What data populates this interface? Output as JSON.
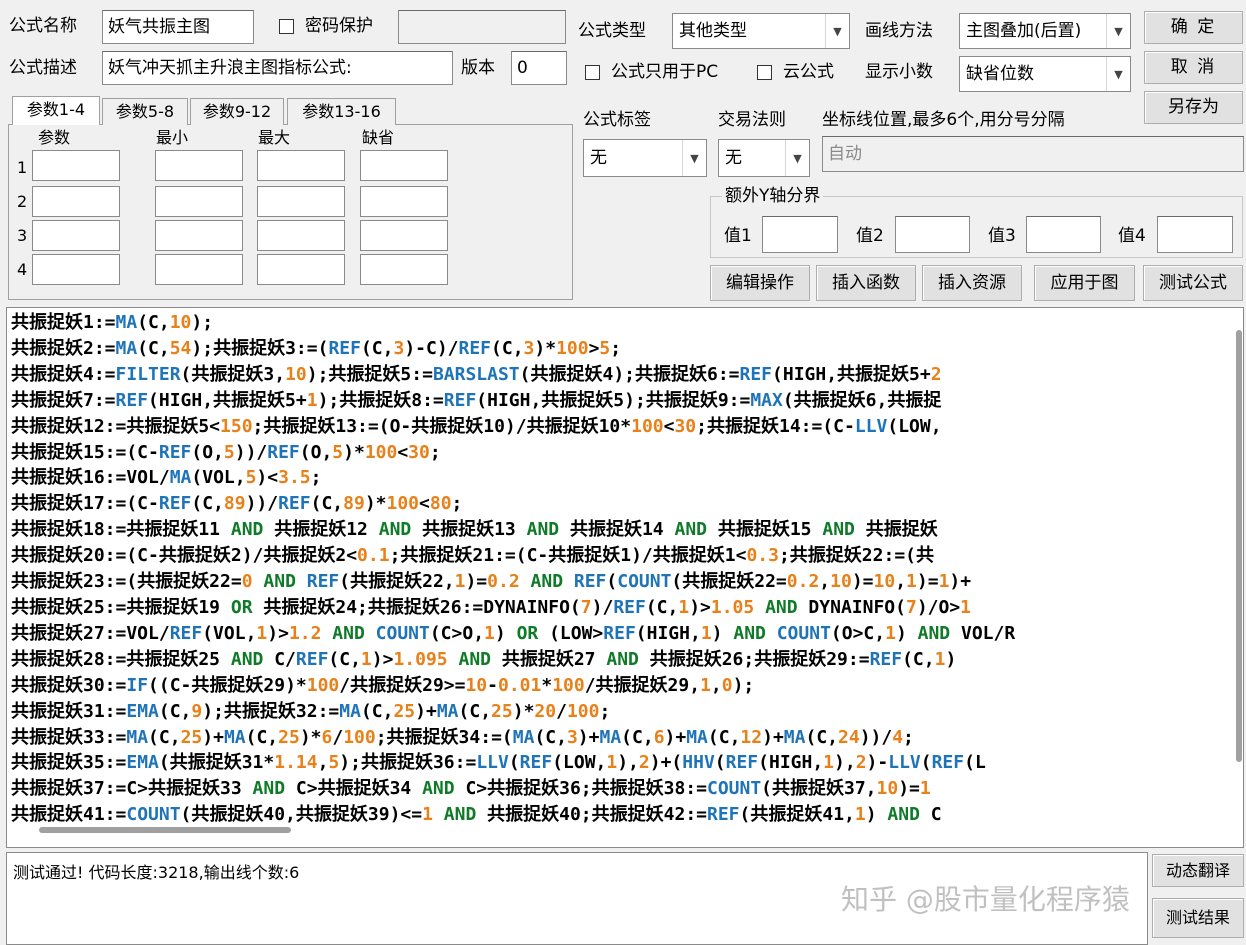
{
  "form": {
    "name_label": "公式名称",
    "name_value": "妖气共振主图",
    "pw_label": "密码保护",
    "desc_label": "公式描述",
    "desc_value": "妖气冲天抓主升浪主图指标公式:",
    "version_label": "版本",
    "version_value": "0",
    "type_label": "公式类型",
    "type_value": "其他类型",
    "draw_label": "画线方法",
    "draw_value": "主图叠加(后置)",
    "pc_only_label": "公式只用于PC",
    "cloud_label": "云公式",
    "decimals_label": "显示小数",
    "decimals_value": "缺省位数",
    "tag_label": "公式标签",
    "tag_value": "无",
    "rule_label": "交易法则",
    "rule_value": "无",
    "axis_label": "坐标线位置,最多6个,用分号分隔",
    "axis_placeholder": "自动",
    "yaxis_group": "额外Y轴分界",
    "val1": "值1",
    "val2": "值2",
    "val3": "值3",
    "val4": "值4"
  },
  "buttons": {
    "ok": "确 定",
    "cancel": "取 消",
    "saveas": "另存为",
    "edit": "编辑操作",
    "insert_func": "插入函数",
    "insert_res": "插入资源",
    "apply": "应用于图",
    "test": "测试公式",
    "translate": "动态翻译",
    "result": "测试结果"
  },
  "tabs": [
    "参数1-4",
    "参数5-8",
    "参数9-12",
    "参数13-16"
  ],
  "param_headers": [
    "参数",
    "最小",
    "最大",
    "缺省"
  ],
  "param_rows": [
    "1",
    "2",
    "3",
    "4"
  ],
  "code_lines": [
    "共振捉妖1:=MA(C,10);",
    "共振捉妖2:=MA(C,54);共振捉妖3:=(REF(C,3)-C)/REF(C,3)*100>5;",
    "共振捉妖4:=FILTER(共振捉妖3,10);共振捉妖5:=BARSLAST(共振捉妖4);共振捉妖6:=REF(HIGH,共振捉妖5+2",
    "共振捉妖7:=REF(HIGH,共振捉妖5+1);共振捉妖8:=REF(HIGH,共振捉妖5);共振捉妖9:=MAX(共振捉妖6,共振捉",
    "共振捉妖12:=共振捉妖5<150;共振捉妖13:=(O-共振捉妖10)/共振捉妖10*100<30;共振捉妖14:=(C-LLV(LOW,",
    "共振捉妖15:=(C-REF(O,5))/REF(O,5)*100<30;",
    "共振捉妖16:=VOL/MA(VOL,5)<3.5;",
    "共振捉妖17:=(C-REF(C,89))/REF(C,89)*100<80;",
    "共振捉妖18:=共振捉妖11 AND 共振捉妖12 AND 共振捉妖13 AND 共振捉妖14 AND 共振捉妖15 AND 共振捉妖",
    "共振捉妖20:=(C-共振捉妖2)/共振捉妖2<0.1;共振捉妖21:=(C-共振捉妖1)/共振捉妖1<0.3;共振捉妖22:=(共",
    "共振捉妖23:=(共振捉妖22=0 AND REF(共振捉妖22,1)=0.2 AND REF(COUNT(共振捉妖22=0.2,10)=10,1)=1)+",
    "共振捉妖25:=共振捉妖19 OR 共振捉妖24;共振捉妖26:=DYNAINFO(7)/REF(C,1)>1.05 AND DYNAINFO(7)/O>1",
    "共振捉妖27:=VOL/REF(VOL,1)>1.2 AND COUNT(C>O,1) OR (LOW>REF(HIGH,1) AND COUNT(O>C,1) AND VOL/R",
    "共振捉妖28:=共振捉妖25 AND C/REF(C,1)>1.095 AND 共振捉妖27 AND 共振捉妖26;共振捉妖29:=REF(C,1)",
    "共振捉妖30:=IF((C-共振捉妖29)*100/共振捉妖29>=10-0.01*100/共振捉妖29,1,0);",
    "共振捉妖31:=EMA(C,9);共振捉妖32:=MA(C,25)+MA(C,25)*20/100;",
    "共振捉妖33:=MA(C,25)+MA(C,25)*6/100;共振捉妖34:=(MA(C,3)+MA(C,6)+MA(C,12)+MA(C,24))/4;",
    "共振捉妖35:=EMA(共振捉妖31*1.14,5);共振捉妖36:=LLV(REF(LOW,1),2)+(HHV(REF(HIGH,1),2)-LLV(REF(L",
    "共振捉妖37:=C>共振捉妖33 AND C>共振捉妖34 AND C>共振捉妖36;共振捉妖38:=COUNT(共振捉妖37,10)=1",
    "共振捉妖41:=COUNT(共振捉妖40,共振捉妖39)<=1 AND 共振捉妖40;共振捉妖42:=REF(共振捉妖41,1) AND C"
  ],
  "status_text": "测试通过! 代码长度:3218,输出线个数:6",
  "watermark": "知乎 @股市量化程序猿"
}
